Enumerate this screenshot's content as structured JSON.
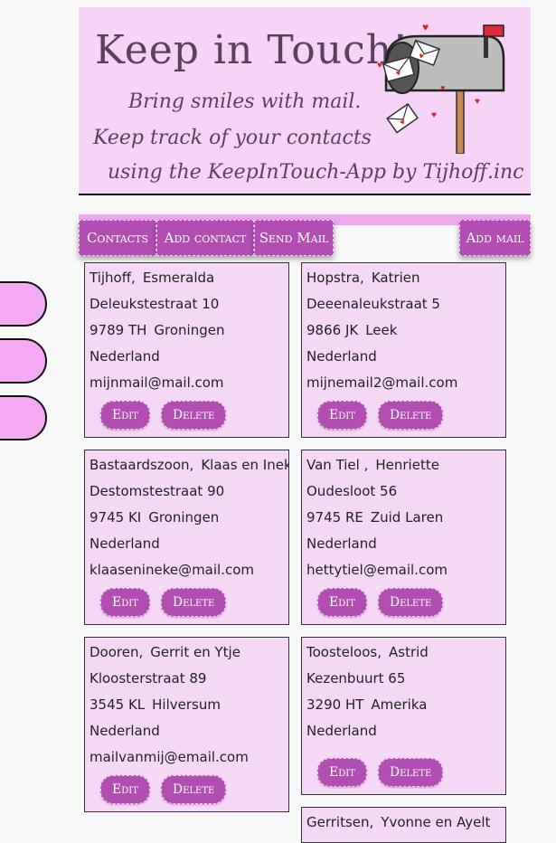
{
  "header": {
    "title": "Keep in Touch!",
    "tagline1": "Bring smiles with mail.",
    "tagline2": "Keep track of your contacts",
    "tagline3": "using the KeepInTouch-App by Tijhoff.inc"
  },
  "nav": {
    "contacts": "Contacts",
    "add_contact": "Add contact",
    "send_mail": "Send Mail",
    "add_mail": "Add mail"
  },
  "buttons": {
    "edit": "Edit",
    "delete": "Delete"
  },
  "contacts": [
    {
      "last": "Tijhoff,",
      "first": "Esmeralda",
      "street": "Deleukstestraat 10",
      "zip": "9789 TH",
      "city": "Groningen",
      "country": "Nederland",
      "email": "mijnmail@mail.com"
    },
    {
      "last": "Hopstra,",
      "first": "Katrien",
      "street": "Deeenaleukstraat 5",
      "zip": "9866 JK",
      "city": "Leek",
      "country": "Nederland",
      "email": "mijnemail2@mail.com"
    },
    {
      "last": "Bastaardszoon,",
      "first": "Klaas en Ineke",
      "street": "Destomstestraat 90",
      "zip": "9745 KI",
      "city": "Groningen",
      "country": "Nederland",
      "email": "klaasenineke@mail.com"
    },
    {
      "last": "Van Tiel ,",
      "first": "Henriette",
      "street": "Oudesloot 56",
      "zip": "9745 RE",
      "city": "Zuid Laren",
      "country": "Nederland",
      "email": "hettytiel@email.com"
    },
    {
      "last": "Dooren,",
      "first": "Gerrit en Ytje",
      "street": "Kloosterstraat 89",
      "zip": "3545 KL",
      "city": "Hilversum",
      "country": "Nederland",
      "email": "mailvanmij@email.com"
    },
    {
      "last": "Toosteloos,",
      "first": "Astrid",
      "street": "Kezenbuurt 65",
      "zip": "3290 HT",
      "city": "Amerika",
      "country": "Nederland",
      "email": ""
    },
    {
      "last": "Gerritsen,",
      "first": "Yvonne en Ayelt",
      "street": "",
      "zip": "",
      "city": "",
      "country": "",
      "email": ""
    }
  ]
}
